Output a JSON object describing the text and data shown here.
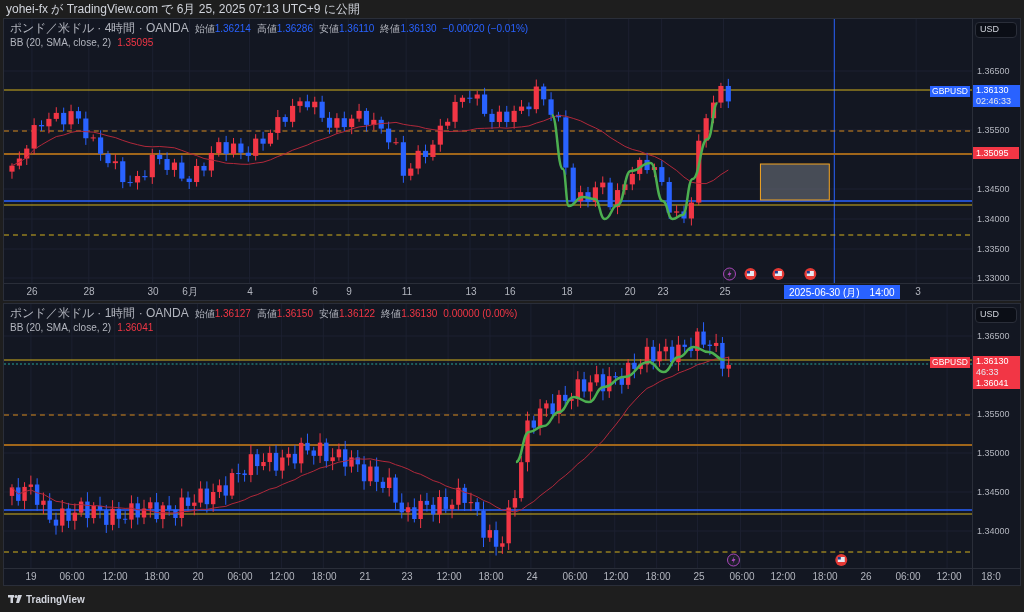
{
  "header": {
    "text": "yohei-fx が TradingView.com で 6月 25, 2025 07:13 UTC+9 に公開"
  },
  "panels": [
    {
      "legend": {
        "color": "#2962ff",
        "symbol": "ポンド／米ドル · 4時間 · OANDA",
        "ohlc": [
          {
            "label": "始値",
            "value": "1.36214"
          },
          {
            "label": "高値",
            "value": "1.36286"
          },
          {
            "label": "安値",
            "value": "1.36110"
          },
          {
            "label": "終値",
            "value": "1.36130"
          }
        ],
        "change": "−0.00020 (−0.01%)",
        "indicator": {
          "label": "BB (20, SMA, close, 2)",
          "value": "1.35095"
        }
      },
      "unit": "USD",
      "price_ticks": [
        "1.36500",
        "1.35500",
        "1.34500",
        "1.34000",
        "1.33500",
        "1.33000"
      ],
      "symbol_tag": "GBPUSD",
      "price_tag": {
        "price": "1.36130",
        "countdown": "02:46:33"
      },
      "bb_tag": "1.35095",
      "time_labels": [
        "26",
        "28",
        "30",
        "6月",
        "4",
        "6",
        "9",
        "11",
        "13",
        "16",
        "18",
        "20",
        "23",
        "25",
        "3"
      ],
      "crosshair_time": {
        "date": "2025-06-30 (月)",
        "time": "14:00"
      }
    },
    {
      "legend": {
        "color": "#f23645",
        "symbol": "ポンド／米ドル · 1時間 · OANDA",
        "ohlc": [
          {
            "label": "始値",
            "value": "1.36127"
          },
          {
            "label": "高値",
            "value": "1.36150"
          },
          {
            "label": "安値",
            "value": "1.36122"
          },
          {
            "label": "終値",
            "value": "1.36130"
          }
        ],
        "change": "0.00000 (0.00%)",
        "indicator": {
          "label": "BB (20, SMA, close, 2)",
          "value": "1.36041"
        }
      },
      "unit": "USD",
      "price_ticks": [
        "1.36500",
        "1.35500",
        "1.35000",
        "1.34500",
        "1.34000"
      ],
      "symbol_tag": "GBPUSD",
      "price_tag": {
        "price": "1.36130",
        "countdown": "46:33",
        "bb": "1.36041"
      },
      "time_labels": [
        "19",
        "06:00",
        "12:00",
        "18:00",
        "20",
        "06:00",
        "12:00",
        "18:00",
        "21",
        "23",
        "12:00",
        "18:00",
        "24",
        "06:00",
        "12:00",
        "18:00",
        "25",
        "06:00",
        "12:00",
        "18:00",
        "26",
        "06:00",
        "12:00",
        "18:0"
      ]
    }
  ],
  "footer": {
    "brand": "TradingView"
  }
}
